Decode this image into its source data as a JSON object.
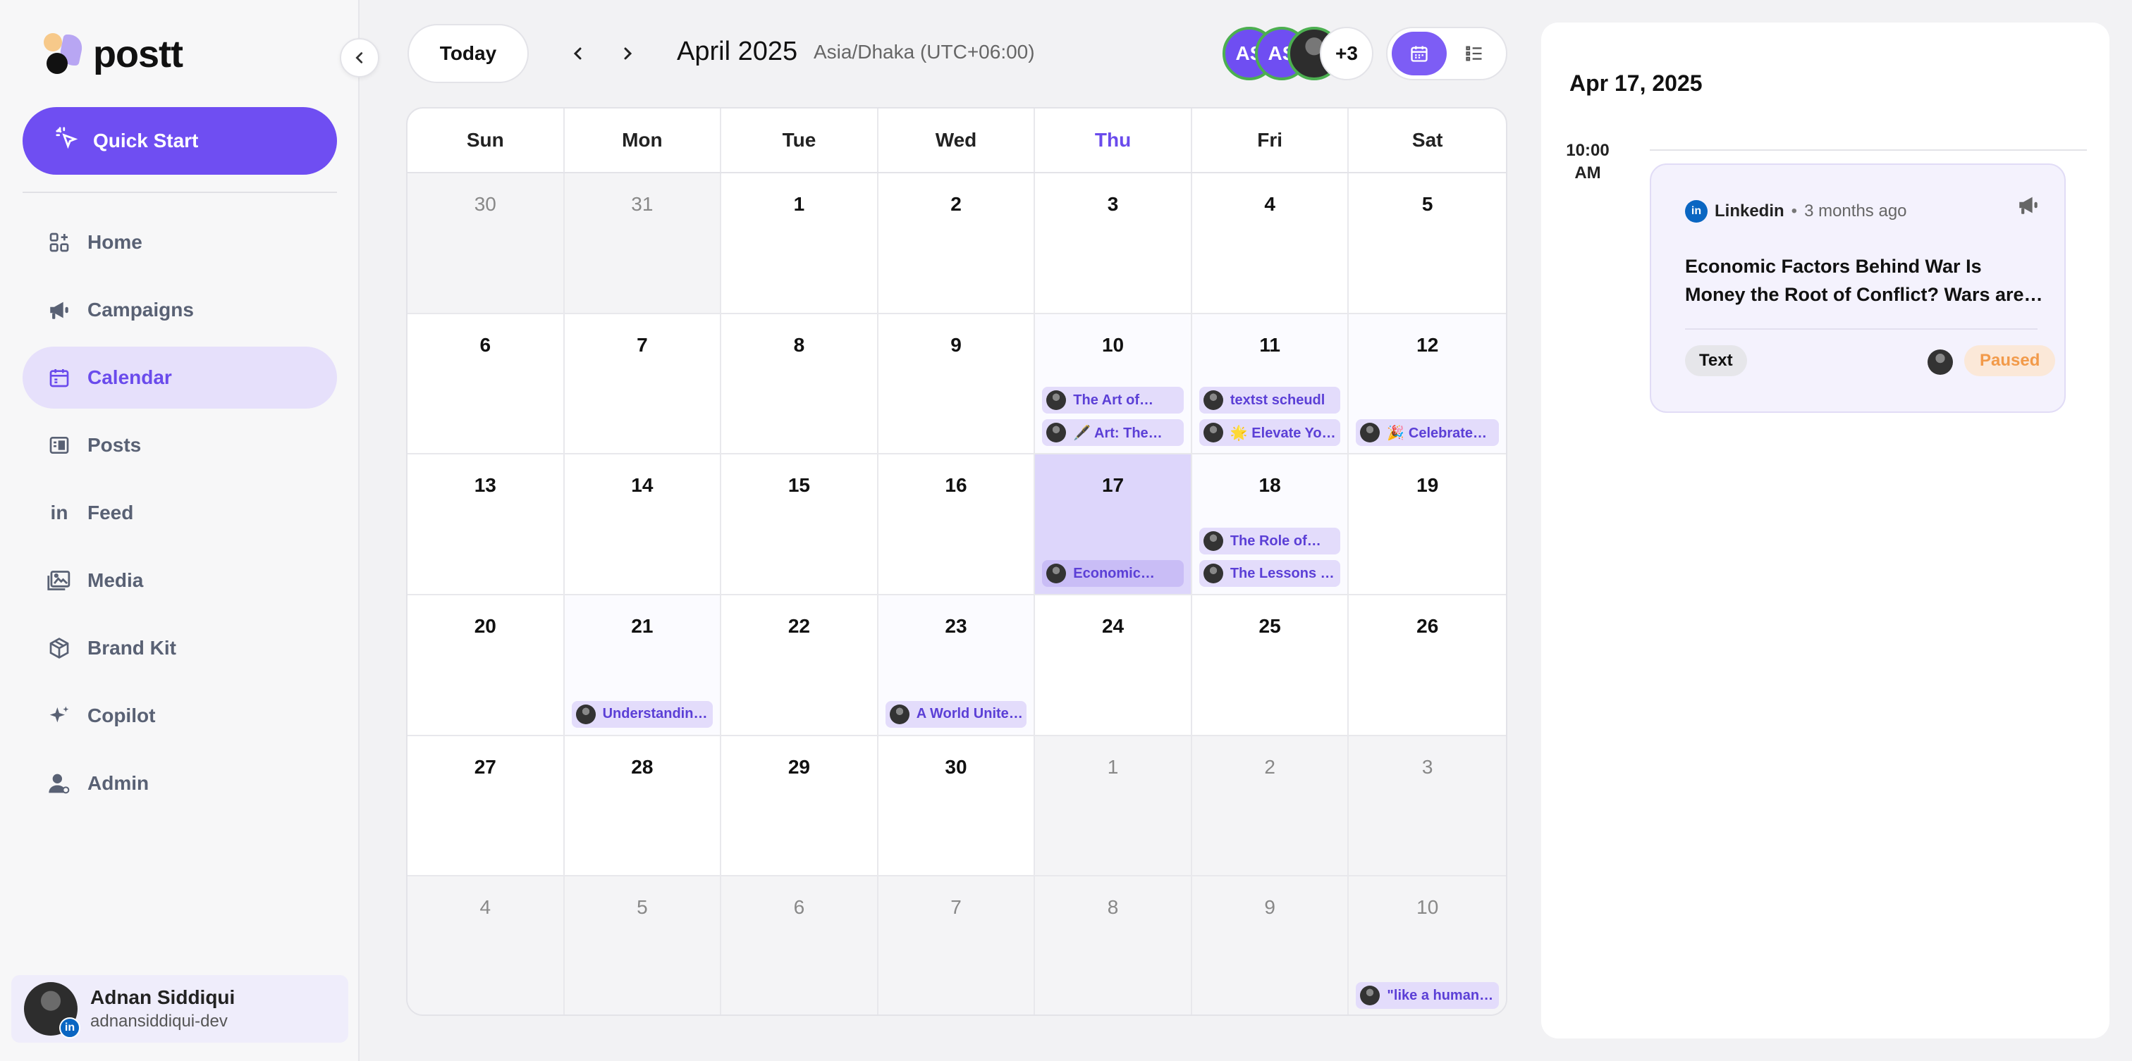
{
  "app": {
    "brand": "postt",
    "quick_start_label": "Quick Start"
  },
  "nav": {
    "items": [
      {
        "label": "Home",
        "icon": "home-icon"
      },
      {
        "label": "Campaigns",
        "icon": "megaphone-icon"
      },
      {
        "label": "Calendar",
        "icon": "calendar-icon",
        "active": true
      },
      {
        "label": "Posts",
        "icon": "posts-icon"
      },
      {
        "label": "Feed",
        "icon": "linkedin-icon"
      },
      {
        "label": "Media",
        "icon": "images-icon"
      },
      {
        "label": "Brand Kit",
        "icon": "box-icon"
      },
      {
        "label": "Copilot",
        "icon": "sparkle-icon"
      },
      {
        "label": "Admin",
        "icon": "user-icon"
      }
    ]
  },
  "user": {
    "name": "Adnan Siddiqui",
    "handle": "adnansiddiqui-dev"
  },
  "toolbar": {
    "today_label": "Today",
    "month_title": "April 2025",
    "timezone": "Asia/Dhaka (UTC+06:00)",
    "avatars": [
      "AS",
      "AS"
    ],
    "more_count": "+3"
  },
  "calendar": {
    "weekdays": [
      "Sun",
      "Mon",
      "Tue",
      "Wed",
      "Thu",
      "Fri",
      "Sat"
    ],
    "today_weekday_index": 4,
    "days": [
      {
        "n": "30",
        "out": true
      },
      {
        "n": "31",
        "out": true
      },
      {
        "n": "1"
      },
      {
        "n": "2"
      },
      {
        "n": "3"
      },
      {
        "n": "4"
      },
      {
        "n": "5"
      },
      {
        "n": "6"
      },
      {
        "n": "7"
      },
      {
        "n": "8"
      },
      {
        "n": "9"
      },
      {
        "n": "10",
        "events": [
          "The Art of…",
          "🖋️ Art: The…"
        ]
      },
      {
        "n": "11",
        "events": [
          "textst scheudl",
          "🌟 Elevate Your…"
        ]
      },
      {
        "n": "12",
        "events": [
          "🎉 Celebrate…"
        ]
      },
      {
        "n": "13"
      },
      {
        "n": "14"
      },
      {
        "n": "15"
      },
      {
        "n": "16"
      },
      {
        "n": "17",
        "selected": true,
        "events": [
          "Economic…"
        ]
      },
      {
        "n": "18",
        "events": [
          "The Role of…",
          "The Lessons of…"
        ]
      },
      {
        "n": "19"
      },
      {
        "n": "20"
      },
      {
        "n": "21",
        "events": [
          "Understanding…"
        ]
      },
      {
        "n": "22"
      },
      {
        "n": "23",
        "events": [
          "A World United:…"
        ]
      },
      {
        "n": "24"
      },
      {
        "n": "25"
      },
      {
        "n": "26"
      },
      {
        "n": "27"
      },
      {
        "n": "28"
      },
      {
        "n": "29"
      },
      {
        "n": "30"
      },
      {
        "n": "1",
        "out": true
      },
      {
        "n": "2",
        "out": true
      },
      {
        "n": "3",
        "out": true
      },
      {
        "n": "4",
        "out": true
      },
      {
        "n": "5",
        "out": true
      },
      {
        "n": "6",
        "out": true
      },
      {
        "n": "7",
        "out": true
      },
      {
        "n": "8",
        "out": true
      },
      {
        "n": "9",
        "out": true
      },
      {
        "n": "10",
        "out": true,
        "events": [
          "\"like a human\"…"
        ]
      }
    ]
  },
  "panel": {
    "date": "Apr 17, 2025",
    "time_label": "10:00 AM",
    "post": {
      "platform": "Linkedin",
      "separator": "•",
      "ago": "3 months ago",
      "text": "Economic Factors Behind War Is Money the Root of Conflict? Wars are…",
      "type": "Text",
      "status": "Paused"
    }
  },
  "colors": {
    "accent": "#6f4ef2",
    "accent_light": "#e6e0fb",
    "linkedin": "#0a66c2",
    "paused": "#f29a4a",
    "online_ring": "#4caf50"
  }
}
